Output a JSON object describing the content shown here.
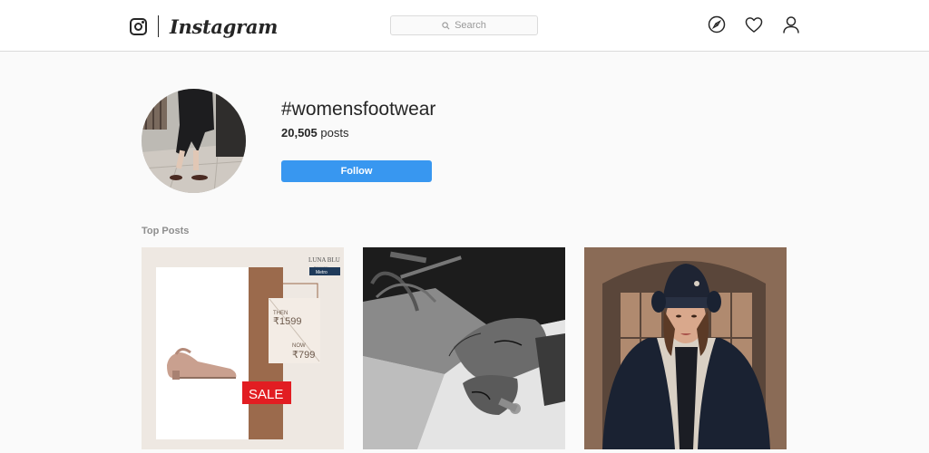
{
  "nav": {
    "brand": "Instagram",
    "search_placeholder": "Search",
    "icons": [
      "explore-icon",
      "activity-heart-icon",
      "profile-icon"
    ]
  },
  "tag": {
    "name": "#womensfootwear",
    "post_count": "20,505",
    "post_suffix": "posts",
    "follow_label": "Follow"
  },
  "top_posts": {
    "title": "Top Posts",
    "items": [
      {
        "brand": "LUNA BLU",
        "brand_sub": "Powered by",
        "brand_badge": "Metro",
        "then_label": "THEN",
        "then_price": "₹1599",
        "now_label": "NOW",
        "now_price": "₹799",
        "sale_label": "SALE"
      },
      {
        "description_text": ""
      },
      {
        "description_text": ""
      }
    ]
  },
  "colors": {
    "accent": "#3897f0",
    "sale_red": "#e21d22",
    "bg": "#fafafa"
  }
}
